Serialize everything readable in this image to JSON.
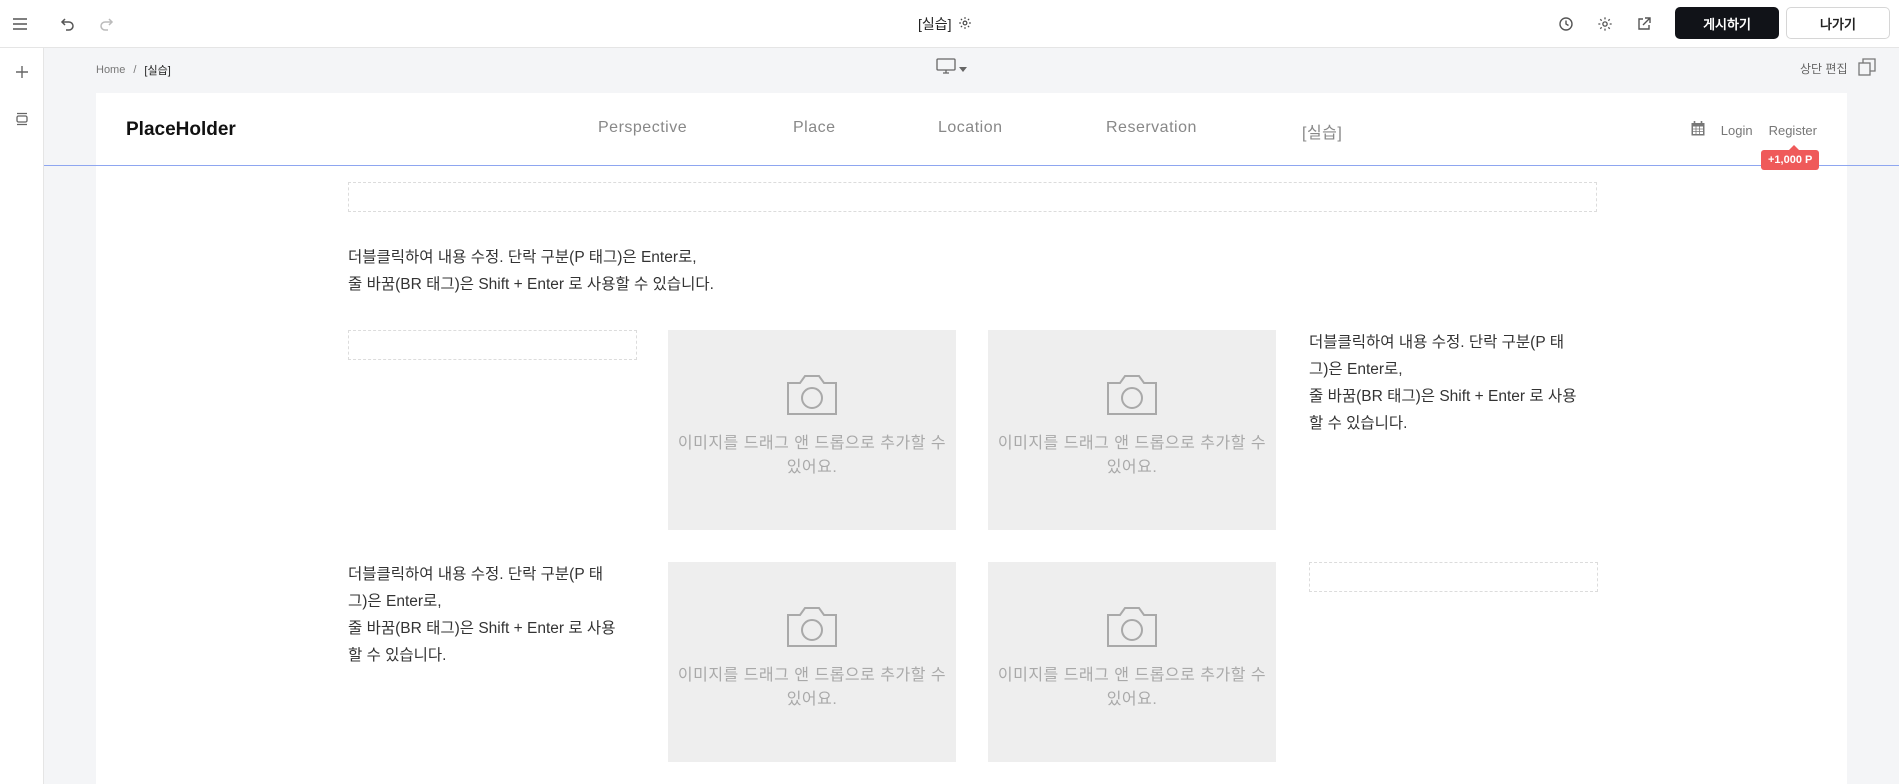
{
  "editor": {
    "page_title": "[실습]",
    "publish_label": "게시하기",
    "exit_label": "나가기",
    "icons": {
      "menu": "hamburger-icon",
      "undo": "undo-icon",
      "redo": "redo-icon",
      "page_settings": "gear-icon",
      "history": "history-icon",
      "settings": "gear-icon",
      "preview": "external-link-icon",
      "add": "plus-icon",
      "sections": "layers-icon",
      "device": "desktop-icon",
      "top_edit": "copy-icon"
    }
  },
  "breadcrumb": {
    "home": "Home",
    "separator": "/",
    "current": "[실습]"
  },
  "top_edit_label": "상단 편집",
  "site": {
    "logo": "PlaceHolder",
    "nav": [
      "Perspective",
      "Place",
      "Location",
      "Reservation",
      "[실습]"
    ],
    "login": "Login",
    "register": "Register",
    "points_badge": "+1,000 P"
  },
  "content": {
    "paragraph_main": [
      "더블클릭하여 내용 수정. 단락 구분(P 태그)은 Enter로,",
      "줄 바꿈(BR 태그)은 Shift + Enter 로 사용할 수 있습니다."
    ],
    "paragraph_narrow": [
      "더블클릭하여 내용 수정. 단락 구분(P 태",
      "그)은 Enter로,",
      "줄 바꿈(BR 태그)은 Shift + Enter 로 사용",
      "할 수 있습니다."
    ],
    "image_placeholder": [
      "이미지를 드래그 앤 드롭으로 추가할 수",
      "있어요."
    ]
  },
  "colors": {
    "publish_bg": "#111318",
    "badge_bg": "#ef5a5a",
    "guide_line": "#8ea6f0",
    "placeholder_bg": "#eeeeee"
  }
}
